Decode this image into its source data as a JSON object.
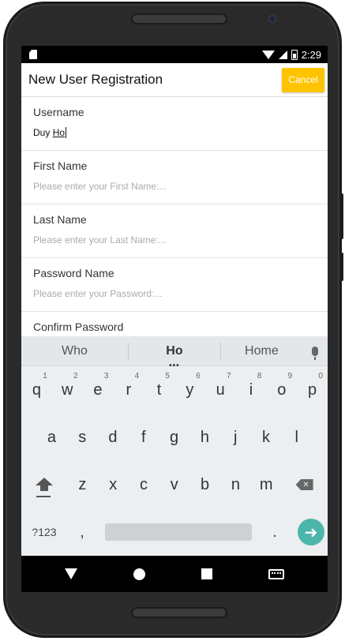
{
  "status_bar": {
    "time": "2:29",
    "icons": [
      "sd-card-icon",
      "wifi-icon",
      "signal-icon",
      "battery-icon"
    ]
  },
  "app_bar": {
    "title": "New User Registration",
    "cancel_label": "Cancel",
    "accent_color": "#ffc400"
  },
  "form": {
    "username": {
      "label": "Username",
      "value_prefix": "Duy ",
      "value_underlined": "Ho"
    },
    "first_name": {
      "label": "First Name",
      "placeholder": "Please enter your First Name:..."
    },
    "last_name": {
      "label": "Last Name",
      "placeholder": "Please enter your Last Name:..."
    },
    "password": {
      "label": "Password Name",
      "placeholder": "Please enter your Password:..."
    },
    "confirm_password": {
      "label": "Confirm Password"
    }
  },
  "keyboard": {
    "suggestions": [
      "Who",
      "Ho",
      "Home"
    ],
    "row1": [
      {
        "key": "q",
        "hint": "1"
      },
      {
        "key": "w",
        "hint": "2"
      },
      {
        "key": "e",
        "hint": "3"
      },
      {
        "key": "r",
        "hint": "4"
      },
      {
        "key": "t",
        "hint": "5"
      },
      {
        "key": "y",
        "hint": "6"
      },
      {
        "key": "u",
        "hint": "7"
      },
      {
        "key": "i",
        "hint": "8"
      },
      {
        "key": "o",
        "hint": "9"
      },
      {
        "key": "p",
        "hint": "0"
      }
    ],
    "row2": [
      "a",
      "s",
      "d",
      "f",
      "g",
      "h",
      "j",
      "k",
      "l"
    ],
    "row3": [
      "z",
      "x",
      "c",
      "v",
      "b",
      "n",
      "m"
    ],
    "symbols_label": "?123",
    "comma": ",",
    "period": ".",
    "enter_color": "#4db6ac"
  },
  "nav_bar": {
    "icons": [
      "back-icon",
      "home-icon",
      "recents-icon",
      "keyboard-icon"
    ]
  }
}
